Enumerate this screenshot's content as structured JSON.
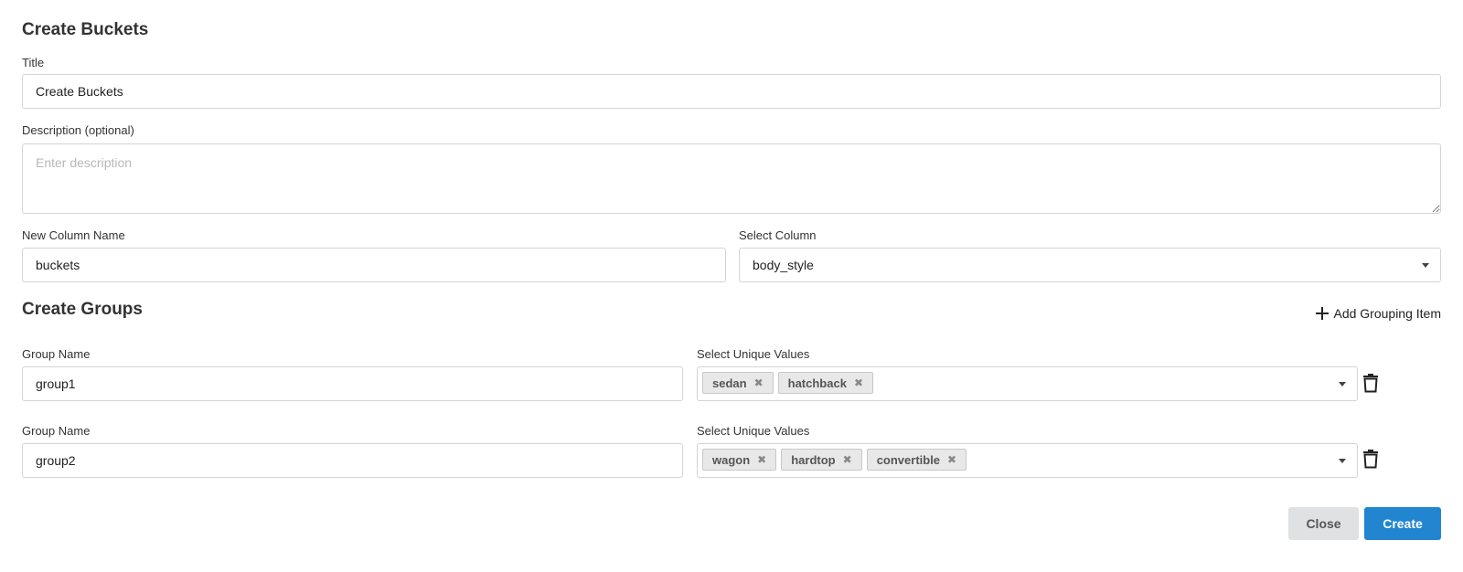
{
  "page": {
    "title": "Create Buckets"
  },
  "form": {
    "title_label": "Title",
    "title_value": "Create Buckets",
    "description_label": "Description (optional)",
    "description_placeholder": "Enter description",
    "new_column_label": "New Column Name",
    "new_column_value": "buckets",
    "select_column_label": "Select Column",
    "select_column_value": "body_style"
  },
  "groups_section": {
    "title": "Create Groups",
    "add_label": "Add Grouping Item"
  },
  "groups": [
    {
      "name_label": "Group Name",
      "name_value": "group1",
      "values_label": "Select Unique Values",
      "values": [
        "sedan",
        "hatchback"
      ]
    },
    {
      "name_label": "Group Name",
      "name_value": "group2",
      "values_label": "Select Unique Values",
      "values": [
        "wagon",
        "hardtop",
        "convertible"
      ]
    }
  ],
  "icons": {
    "tag_remove": "close-icon",
    "delete": "trash-icon",
    "add": "plus-icon",
    "dropdown": "caret-down-icon"
  },
  "colors": {
    "primary": "#2185d0",
    "secondary": "#e0e1e2"
  },
  "buttons": {
    "close": "Close",
    "create": "Create"
  }
}
